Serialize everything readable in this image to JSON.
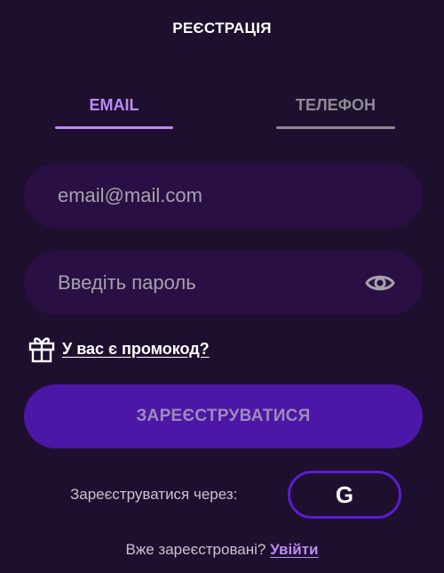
{
  "header": {
    "title": "РЕЄСТРАЦІЯ"
  },
  "tabs": [
    {
      "label": "EMAIL",
      "active": true
    },
    {
      "label": "ТЕЛЕФОН",
      "active": false
    }
  ],
  "form": {
    "email_placeholder": "email@mail.com",
    "password_placeholder": "Введіть пароль",
    "promo_link": "У вас є промокод?",
    "register_button": "ЗАРЕЄСТРУВАТИСЯ",
    "social_label": "Зареєструватися через:",
    "google_letter": "G"
  },
  "footer": {
    "question": "Вже зареєстровані?",
    "login_link": "Увійти"
  },
  "colors": {
    "background": "#1f0f2e",
    "field_background": "#2a0f45",
    "accent": "#b98cf7",
    "button": "#4c16a6",
    "button_text": "#9d8cb8",
    "outline": "#5a1ed1"
  },
  "icons": {
    "password_toggle": "eye-icon",
    "promo": "gift-icon",
    "social": "google-icon"
  }
}
